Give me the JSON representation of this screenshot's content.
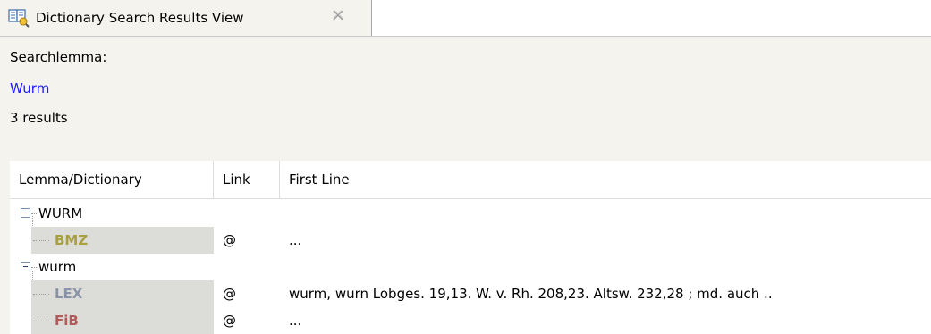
{
  "tab": {
    "title": "Dictionary Search Results View",
    "icon": "dictionary-search-icon",
    "close_icon": "close-icon"
  },
  "search": {
    "label": "Searchlemma:",
    "lemma": "Wurm",
    "results_count": "3 results"
  },
  "table": {
    "columns": [
      "Lemma/Dictionary",
      "Link",
      "First Line"
    ],
    "groups": [
      {
        "lemma": "WURM",
        "children": [
          {
            "dictionary": "BMZ",
            "link": "@",
            "first_line": "...",
            "color": "#a8a040"
          }
        ]
      },
      {
        "lemma": "wurm",
        "children": [
          {
            "dictionary": "LEX",
            "link": "@",
            "first_line": "wurm, wurn Lobges. 19,13. W. v. Rh. 208,23. Altsw. 232,28 ; md. auch ..",
            "color": "#8a94a8"
          },
          {
            "dictionary": "FiB",
            "link": "@",
            "first_line": "...",
            "color": "#b05a5a"
          }
        ]
      }
    ]
  }
}
